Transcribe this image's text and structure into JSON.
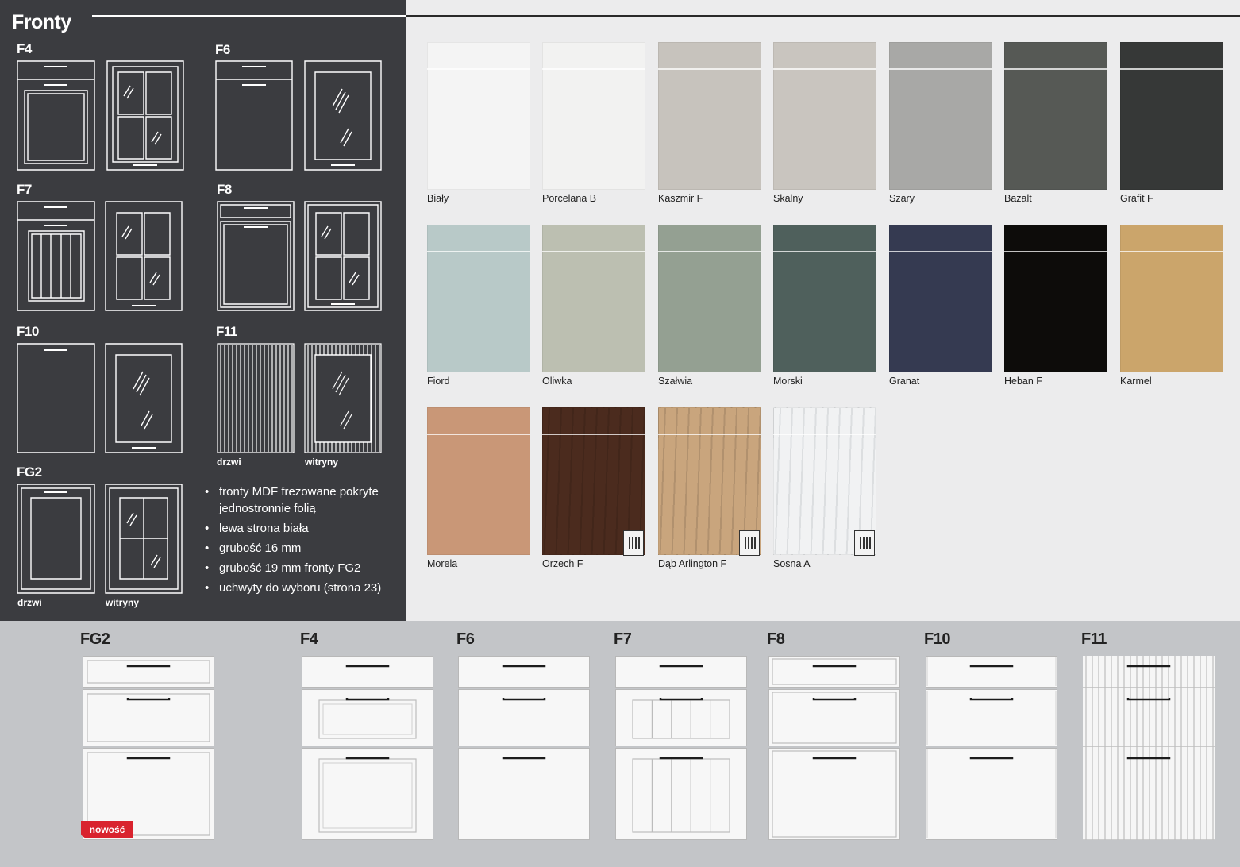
{
  "page": {
    "title": "Fronty"
  },
  "left_panel": {
    "models": [
      {
        "id": "f4",
        "label": "F4"
      },
      {
        "id": "f6",
        "label": "F6"
      },
      {
        "id": "f7",
        "label": "F7"
      },
      {
        "id": "f8",
        "label": "F8"
      },
      {
        "id": "f10",
        "label": "F10"
      },
      {
        "id": "f11",
        "label": "F11"
      },
      {
        "id": "fg2",
        "label": "FG2"
      }
    ],
    "sub_labels": {
      "doors": "drzwi",
      "showcases": "witryny"
    },
    "specs": [
      "fronty MDF frezowane pokryte jednostronnie folią",
      "lewa strona biała",
      "grubość 16 mm",
      "grubość 19 mm fronty FG2",
      "uchwyty do wyboru (strona 23)"
    ]
  },
  "colors": [
    {
      "name": "Biały",
      "hex": "#f4f4f4",
      "wood": false
    },
    {
      "name": "Porcelana B",
      "hex": "#f2f2f1",
      "wood": false
    },
    {
      "name": "Kaszmir F",
      "hex": "#c7c3bd",
      "wood": false
    },
    {
      "name": "Skalny",
      "hex": "#c9c5bf",
      "wood": false
    },
    {
      "name": "Szary",
      "hex": "#a8a8a6",
      "wood": false
    },
    {
      "name": "Bazalt",
      "hex": "#565955",
      "wood": false
    },
    {
      "name": "Grafit F",
      "hex": "#363837",
      "wood": false
    },
    {
      "name": "Fiord",
      "hex": "#b8c9c8",
      "wood": false
    },
    {
      "name": "Oliwka",
      "hex": "#bcbfb1",
      "wood": false
    },
    {
      "name": "Szałwia",
      "hex": "#94a092",
      "wood": false
    },
    {
      "name": "Morski",
      "hex": "#4f605c",
      "wood": false
    },
    {
      "name": "Granat",
      "hex": "#353a51",
      "wood": false
    },
    {
      "name": "Heban F",
      "hex": "#0d0c0a",
      "wood": false
    },
    {
      "name": "Karmel",
      "hex": "#cba56b",
      "wood": false
    },
    {
      "name": "Morela",
      "hex": "#c99777",
      "wood": false
    },
    {
      "name": "Orzech F",
      "hex": "#4b2b1e",
      "wood": true
    },
    {
      "name": "Dąb Arlington F",
      "hex": "#c9a57d",
      "wood": true
    },
    {
      "name": "Sosna A",
      "hex": "#f1f2f3",
      "wood": true
    }
  ],
  "bottom": {
    "fronts": [
      {
        "label": "FG2"
      },
      {
        "label": "F4"
      },
      {
        "label": "F6"
      },
      {
        "label": "F7"
      },
      {
        "label": "F8"
      },
      {
        "label": "F10"
      },
      {
        "label": "F11"
      }
    ],
    "new_badge": "nowość"
  }
}
